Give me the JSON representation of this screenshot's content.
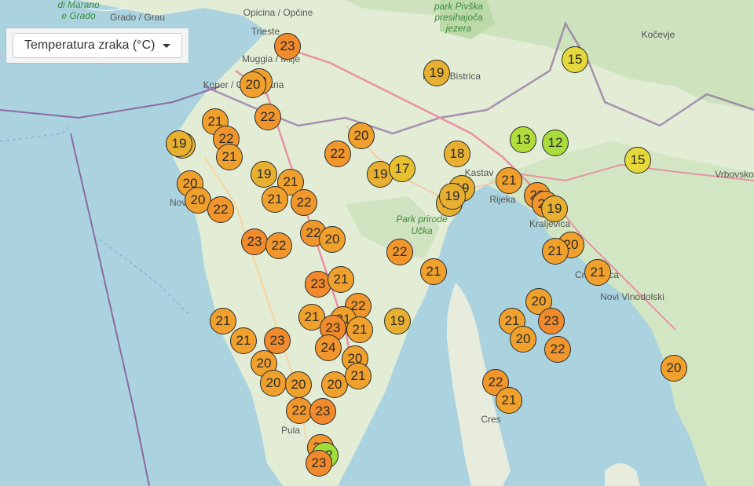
{
  "control": {
    "dropdown_label": "Temperatura zraka (°C)"
  },
  "labels": [
    {
      "text": "di Marano",
      "green": true
    },
    {
      "text": "e Grado",
      "green": true
    },
    {
      "text": "Grado / Grau"
    },
    {
      "text": "Opicina / Opčine"
    },
    {
      "text": "park Pivška",
      "green": true
    },
    {
      "text": "presihajoča",
      "green": true
    },
    {
      "text": "jezera",
      "green": true
    },
    {
      "text": "Kočevje"
    },
    {
      "text": "Trieste"
    },
    {
      "text": "Muggia / Milje"
    },
    {
      "text": "Koper / Capodistria"
    },
    {
      "text": "Ilirska Bistrica"
    },
    {
      "text": "Kastav"
    },
    {
      "text": "Rijeka"
    },
    {
      "text": "Kraljevica"
    },
    {
      "text": "Crikvenica"
    },
    {
      "text": "Novi Vinodolski"
    },
    {
      "text": "Park prirode",
      "green": true
    },
    {
      "text": "Učka",
      "green": true
    },
    {
      "text": "Cres"
    },
    {
      "text": "Pula"
    },
    {
      "text": "Vrbovsko"
    },
    {
      "text": "Novigrad"
    }
  ],
  "stations": [
    {
      "t": "23",
      "c": "#f08a2c"
    },
    {
      "t": "20",
      "c": "#f0a02c"
    },
    {
      "t": "20",
      "c": "#f0a02c"
    },
    {
      "t": "19",
      "c": "#e8b030"
    },
    {
      "t": "15",
      "c": "#e4d83a"
    },
    {
      "t": "22",
      "c": "#f0962c"
    },
    {
      "t": "21",
      "c": "#f0a02c"
    },
    {
      "t": "22",
      "c": "#f0962c"
    },
    {
      "t": "19",
      "c": "#e8b030"
    },
    {
      "t": "19",
      "c": "#e8b030"
    },
    {
      "t": "21",
      "c": "#f0a02c"
    },
    {
      "t": "20",
      "c": "#f0a02c"
    },
    {
      "t": "22",
      "c": "#f0962c"
    },
    {
      "t": "18",
      "c": "#e8b030"
    },
    {
      "t": "13",
      "c": "#b0dc3c"
    },
    {
      "t": "12",
      "c": "#a8dc3c"
    },
    {
      "t": "15",
      "c": "#e4d83a"
    },
    {
      "t": "19",
      "c": "#e8b030"
    },
    {
      "t": "21",
      "c": "#f0a02c"
    },
    {
      "t": "19",
      "c": "#e8b030"
    },
    {
      "t": "17",
      "c": "#e8c030"
    },
    {
      "t": "20",
      "c": "#f0a02c"
    },
    {
      "t": "20",
      "c": "#f0a02c"
    },
    {
      "t": "21",
      "c": "#f0a02c"
    },
    {
      "t": "22",
      "c": "#f0962c"
    },
    {
      "t": "22",
      "c": "#f0962c"
    },
    {
      "t": "19",
      "c": "#e8b030"
    },
    {
      "t": "19",
      "c": "#e8b030"
    },
    {
      "t": "19",
      "c": "#e8b030"
    },
    {
      "t": "21",
      "c": "#f0a02c"
    },
    {
      "t": "22",
      "c": "#f0962c"
    },
    {
      "t": "22",
      "c": "#f0962c"
    },
    {
      "t": "19",
      "c": "#e8b030"
    },
    {
      "t": "23",
      "c": "#f08a2c"
    },
    {
      "t": "22",
      "c": "#f0962c"
    },
    {
      "t": "22",
      "c": "#f0962c"
    },
    {
      "t": "20",
      "c": "#f0a02c"
    },
    {
      "t": "22",
      "c": "#f0962c"
    },
    {
      "t": "20",
      "c": "#f0a02c"
    },
    {
      "t": "21",
      "c": "#f0a02c"
    },
    {
      "t": "23",
      "c": "#f08a2c"
    },
    {
      "t": "21",
      "c": "#f0a02c"
    },
    {
      "t": "21",
      "c": "#f0a02c"
    },
    {
      "t": "21",
      "c": "#f0a02c"
    },
    {
      "t": "22",
      "c": "#f0962c"
    },
    {
      "t": "20",
      "c": "#f0a02c"
    },
    {
      "t": "21",
      "c": "#f0a02c"
    },
    {
      "t": "19",
      "c": "#e8b030"
    },
    {
      "t": "21",
      "c": "#f0a02c"
    },
    {
      "t": "21",
      "c": "#f0a02c"
    },
    {
      "t": "21",
      "c": "#f0a02c"
    },
    {
      "t": "21",
      "c": "#f0a02c"
    },
    {
      "t": "23",
      "c": "#f08a2c"
    },
    {
      "t": "21",
      "c": "#f0a02c"
    },
    {
      "t": "23",
      "c": "#f08a2c"
    },
    {
      "t": "23",
      "c": "#f08a2c"
    },
    {
      "t": "24",
      "c": "#f0962c"
    },
    {
      "t": "20",
      "c": "#f0a02c"
    },
    {
      "t": "22",
      "c": "#f0962c"
    },
    {
      "t": "20",
      "c": "#f0a02c"
    },
    {
      "t": "20",
      "c": "#f0a02c"
    },
    {
      "t": "20",
      "c": "#f0a02c"
    },
    {
      "t": "20",
      "c": "#f0a02c"
    },
    {
      "t": "20",
      "c": "#f0a02c"
    },
    {
      "t": "21",
      "c": "#f0a02c"
    },
    {
      "t": "22",
      "c": "#f0962c"
    },
    {
      "t": "21",
      "c": "#f0a02c"
    },
    {
      "t": "22",
      "c": "#f0962c"
    },
    {
      "t": "23",
      "c": "#f08a2c"
    },
    {
      "t": "20",
      "c": "#f0a02c"
    },
    {
      "t": "22",
      "c": "#f0962c"
    },
    {
      "t": "12",
      "c": "#a0dc3c"
    },
    {
      "t": "23",
      "c": "#f08a2c"
    }
  ]
}
